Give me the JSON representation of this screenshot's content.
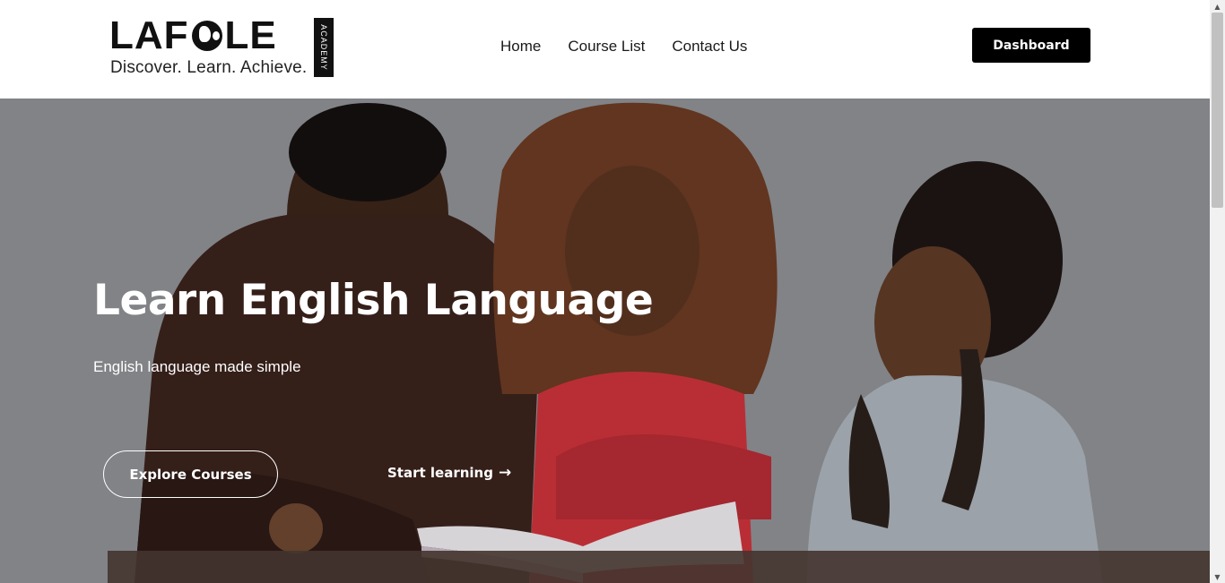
{
  "header": {
    "logo": {
      "word_left": "LAF",
      "word_right": "LE",
      "side_label": "ACADEMY",
      "tagline": "Discover. Learn. Achieve."
    },
    "nav": [
      {
        "label": "Home"
      },
      {
        "label": "Course List"
      },
      {
        "label": "Contact Us"
      }
    ],
    "dashboard_label": "Dashboard"
  },
  "hero": {
    "title": "Learn English Language",
    "subtitle": "English language made simple",
    "explore_label": "Explore Courses",
    "start_label": "Start learning",
    "start_icon": "arrow-right-icon",
    "background_color": "#8d8f93"
  },
  "colors": {
    "brand_black": "#000000",
    "text_white": "#ffffff"
  }
}
